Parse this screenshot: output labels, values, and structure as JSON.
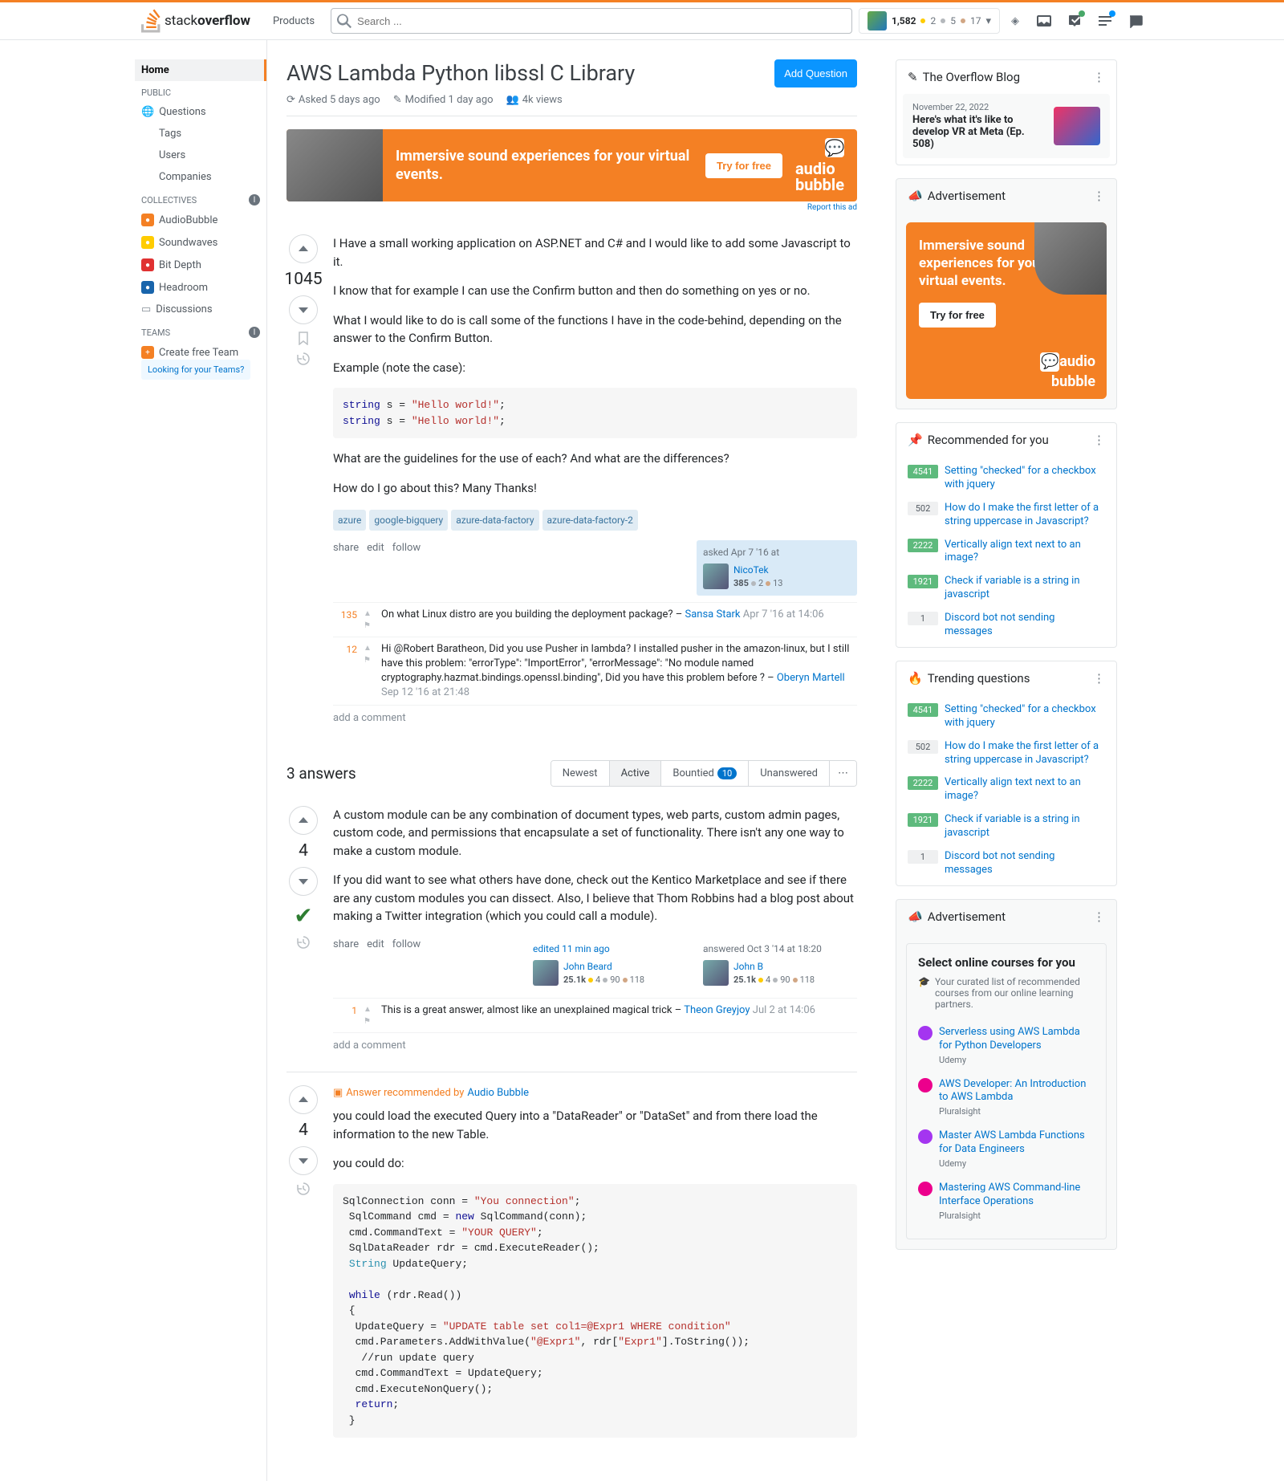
{
  "topbar": {
    "products": "Products",
    "search_placeholder": "Search ...",
    "rep": "1,582",
    "badges": {
      "gold": "2",
      "silver": "5",
      "bronze": "17"
    }
  },
  "leftnav": {
    "home": "Home",
    "public": "PUBLIC",
    "questions": "Questions",
    "tags": "Tags",
    "users": "Users",
    "companies": "Companies",
    "collectives": "COLLECTIVES",
    "coll_items": [
      {
        "name": "AudioBubble",
        "color": "#f48024"
      },
      {
        "name": "Soundwaves",
        "color": "#ffcc01"
      },
      {
        "name": "Bit Depth",
        "color": "#e03131"
      },
      {
        "name": "Headroom",
        "color": "#1864ab"
      }
    ],
    "discussions": "Discussions",
    "teams": "TEAMS",
    "create_team": "Create free Team",
    "looking": "Looking for your Teams?"
  },
  "question": {
    "title": "AWS Lambda Python libssl C Library",
    "add": "Add Question",
    "asked": "Asked 5 days ago",
    "modified": "Modified 1 day ago",
    "views": "4k views",
    "body": {
      "p1": "I Have a small working application on ASP.NET and C# and I would like to add some Javascript to it.",
      "p2": "I know that for example I can use the Confirm button and then do something on yes or no.",
      "p3": "What I would like to do is call some of the functions I have in the code-behind, depending on the answer to the Confirm Button.",
      "p4": "Example (note the case):",
      "p5": "What are the guidelines for the use of each? And what are the differences?",
      "p6": "How do I go about this? Many Thanks!"
    },
    "tags": [
      "azure",
      "google-bigquery",
      "azure-data-factory",
      "azure-data-factory-2"
    ],
    "score": "1045",
    "actions": {
      "share": "share",
      "edit": "edit",
      "follow": "follow"
    },
    "asker": {
      "when": "asked Apr 7 '16 at",
      "name": "NicoTek",
      "rep": "385",
      "silver": "2",
      "bronze": "13"
    },
    "comments": [
      {
        "score": "135",
        "text": "On what Linux distro are you building the deployment package? – ",
        "user": "Sansa Stark",
        "date": "Apr 7 '16 at 14:06"
      },
      {
        "score": "12",
        "text": "Hi @Robert Baratheon, Did you use Pusher in lambda? I installed pusher in the amazon-linux, but I still have this problem: \"errorType\": \"ImportError\",    \"errorMessage\": \"No module named cryptography.hazmat.bindings.openssl.binding\", Did you have this problem before ? – ",
        "user": "Oberyn Martell",
        "date": "Sep 12 '16 at 21:48"
      }
    ],
    "addcomment": "add a comment"
  },
  "ad1": {
    "headline": "Immersive sound experiences for your virtual events.",
    "cta": "Try for free",
    "brand": "audio\nbubble",
    "report": "Report this ad"
  },
  "answers": {
    "count": "3 answers",
    "tabs": {
      "newest": "Newest",
      "active": "Active",
      "bountied": "Bountied",
      "bountied_n": "10",
      "unanswered": "Unanswered"
    }
  },
  "ans1": {
    "score": "4",
    "p1": "A custom module can be any combination of document types, web parts, custom admin pages, custom code, and permissions that encapsulate a set of functionality. There isn't any one way to make a custom module.",
    "p2": "If you did want to see what others have done, check out the Kentico Marketplace and see if there are any custom modules you can dissect. Also, I believe that Thom Robbins had a blog post about making a Twitter integration (which you could call a module).",
    "edited": {
      "when": "edited 11 min ago",
      "name": "John Beard",
      "rep": "25.1k",
      "gold": "4",
      "silver": "90",
      "bronze": "118"
    },
    "answered": {
      "when": "answered Oct 3 '14 at 18:20",
      "name": "John B",
      "rep": "25.1k",
      "gold": "4",
      "silver": "90",
      "bronze": "118"
    },
    "comments": [
      {
        "score": "1",
        "text": "This is a great answer, almost like an unexplained magical trick – ",
        "user": "Theon Greyjoy",
        "date": "Jul 2 at 14:06"
      }
    ]
  },
  "ans2": {
    "score": "4",
    "rec": "Answer recommended by",
    "rec_by": "Audio Bubble",
    "p1": "you could load the executed Query into a \"DataReader\" or \"DataSet\" and from there load the information to the new Table.",
    "p2": "you could do:"
  },
  "right": {
    "blog_head": "The Overflow Blog",
    "blog": {
      "date": "November 22, 2022",
      "title": "Here's what it's like to develop VR at Meta (Ep. 508)"
    },
    "adv": "Advertisement",
    "ad": {
      "headline": "Immersive sound experiences for your virtual events.",
      "cta": "Try for free",
      "brand": "audio\nbubble"
    },
    "rec_head": "Recommended for you",
    "rec": [
      {
        "n": "4541",
        "cls": "",
        "t": "Setting \"checked\" for a checkbox with jquery"
      },
      {
        "n": "502",
        "cls": "grey",
        "t": "How do I make the first letter of a string uppercase in Javascript?"
      },
      {
        "n": "2222",
        "cls": "",
        "t": "Vertically align text next to an image?"
      },
      {
        "n": "1921",
        "cls": "",
        "t": "Check if variable is a string in javascript"
      },
      {
        "n": "1",
        "cls": "grey",
        "t": "Discord bot not sending messages"
      }
    ],
    "trend_head": "Trending questions",
    "trend": [
      {
        "n": "4541",
        "cls": "",
        "t": "Setting \"checked\" for a checkbox with jquery"
      },
      {
        "n": "502",
        "cls": "grey",
        "t": "How do I make the first letter of a string uppercase in Javascript?"
      },
      {
        "n": "2222",
        "cls": "",
        "t": "Vertically align text next to an image?"
      },
      {
        "n": "1921",
        "cls": "",
        "t": "Check if variable is a string in javascript"
      },
      {
        "n": "1",
        "cls": "grey",
        "t": "Discord bot not sending messages"
      }
    ],
    "courses_head": "Select online courses for you",
    "courses_sub": "Your curated list of recommended courses from our online learning partners.",
    "courses": [
      {
        "p": "u",
        "t": "Serverless using AWS Lambda for Python Developers",
        "v": "Udemy"
      },
      {
        "p": "p",
        "t": "AWS Developer: An Introduction to AWS Lambda",
        "v": "Pluralsight"
      },
      {
        "p": "u",
        "t": "Master AWS Lambda Functions for Data Engineers",
        "v": "Udemy"
      },
      {
        "p": "p",
        "t": "Mastering AWS Command-line Interface Operations",
        "v": "Pluralsight"
      }
    ]
  }
}
